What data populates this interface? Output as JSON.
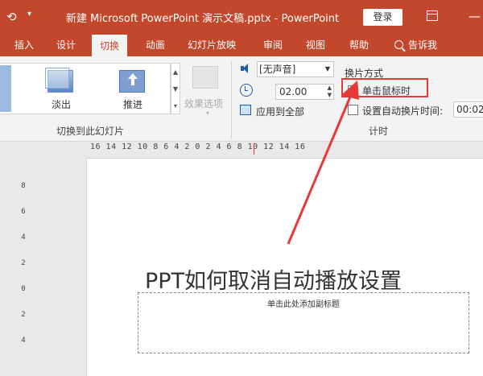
{
  "titlebar": {
    "title": "新建 Microsoft PowerPoint 演示文稿.pptx  -  PowerPoint",
    "login_label": "登录",
    "qa_icon": "quick-access-icon",
    "toggle_icon": "ribbon-display-icon",
    "minimize_symbol": "—"
  },
  "tabs": {
    "insert": "插入",
    "design": "设计",
    "transitions": "切换",
    "animations": "动画",
    "slideshow": "幻灯片放映",
    "review": "审阅",
    "view": "视图",
    "help": "帮助",
    "tellme": "告诉我"
  },
  "ribbon": {
    "gallery": {
      "fade_label": "淡出",
      "push_label": "推进"
    },
    "effect_options_label": "效果选项",
    "group_transition_label": "切换到此幻灯片",
    "timing": {
      "sound_value": "[无声音]",
      "duration_value": "02.00",
      "apply_all_label": "应用到全部",
      "advance_title": "换片方式",
      "on_click_label": "单击鼠标时",
      "on_click_checked": "✓",
      "after_label": "设置自动换片时间:",
      "after_value": "00:02",
      "group_timing_label": "计时"
    }
  },
  "ruler": {
    "horizontal": "16 14 12 10 8 6 4 2 0 2 4 6 8 10 12 14 16",
    "vertical": [
      "8",
      "6",
      "4",
      "2",
      "0",
      "2",
      "4"
    ]
  },
  "slide": {
    "title": "PPT如何取消自动播放设置",
    "subtitle_placeholder": "单击此处添加副标题"
  },
  "colors": {
    "accent": "#c2472b",
    "highlight": "#e53935"
  }
}
